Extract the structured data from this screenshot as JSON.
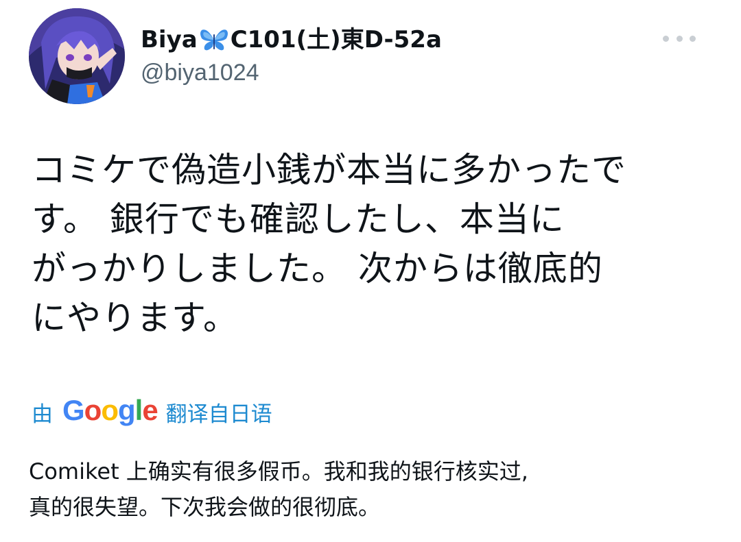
{
  "author": {
    "display_name_part1": "Biya",
    "display_name_part2": "C101(土)東D-52a",
    "handle": "@biya1024",
    "avatar_icon": "anime-character-avatar",
    "emoji_icon": "butterfly-icon"
  },
  "menu": {
    "more_icon": "more-horizontal-icon"
  },
  "tweet": {
    "lines": [
      "コミケで偽造小銭が本当に多かったで",
      "す。 銀行でも確認したし、本当に",
      "がっかりしました。 次からは徹底的",
      "にやります。"
    ]
  },
  "translation": {
    "prefix": "由",
    "provider_letters": [
      "G",
      "o",
      "o",
      "g",
      "l",
      "e"
    ],
    "suffix": "翻译自日语",
    "lines": [
      "Comiket 上确实有很多假币。我和我的银行核实过,",
      "真的很失望。下次我会做的很彻底。"
    ]
  },
  "colors": {
    "text": "#0f1419",
    "secondary": "#536471",
    "link": "#1d8ad0",
    "google_blue": "#4285f4",
    "google_red": "#ea4335",
    "google_yellow": "#fbbc05",
    "google_green": "#34a853"
  }
}
